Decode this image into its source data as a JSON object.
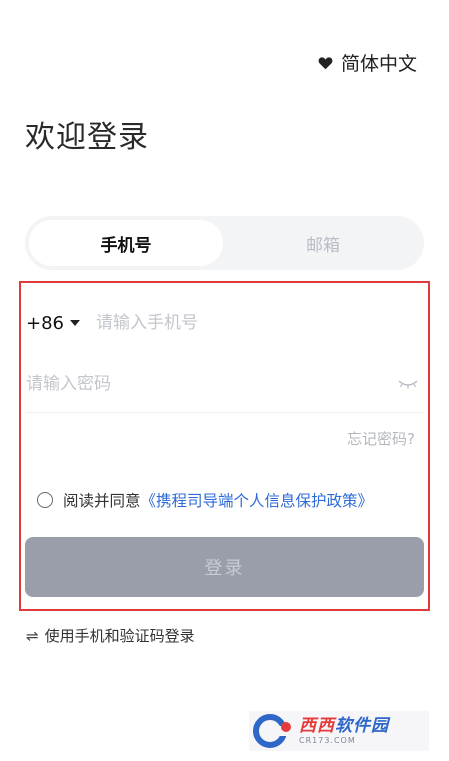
{
  "header": {
    "language_label": "简体中文",
    "language_icon": "heart-icon",
    "title": "欢迎登录"
  },
  "tabs": [
    {
      "label": "手机号",
      "active": true
    },
    {
      "label": "邮箱",
      "active": false
    }
  ],
  "form": {
    "country_code": "+86",
    "phone_placeholder": "请输入手机号",
    "password_placeholder": "请输入密码",
    "forgot_label": "忘记密码?",
    "agree_prefix": "阅读并同意",
    "policy_link": "《携程司导端个人信息保护政策》",
    "agree_checked": false,
    "login_label": "登录",
    "switch_label": "使用手机和验证码登录",
    "switch_icon": "⇌"
  },
  "watermark": {
    "brand_part1": "西西",
    "brand_part2": "软件园",
    "domain": "CR173.COM"
  },
  "colors": {
    "accent_link": "#2f6bd8",
    "highlight_border": "#e23a3a",
    "button_disabled": "#9a9eaa"
  }
}
